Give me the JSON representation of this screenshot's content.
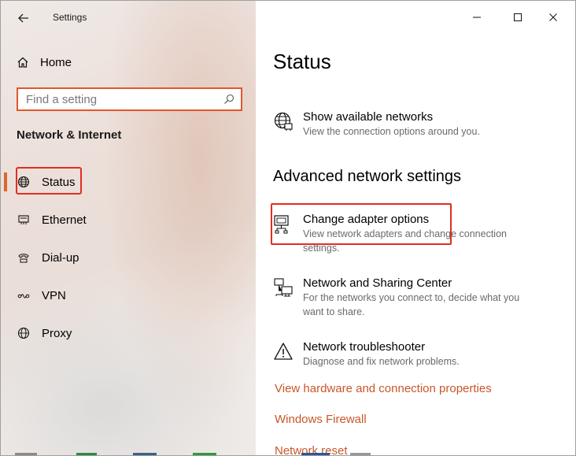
{
  "window": {
    "app_title": "Settings"
  },
  "sidebar": {
    "home_label": "Home",
    "search_placeholder": "Find a setting",
    "section_title": "Network & Internet",
    "items": [
      {
        "label": "Status",
        "icon": "globe-icon",
        "active": true
      },
      {
        "label": "Ethernet",
        "icon": "ethernet-icon"
      },
      {
        "label": "Dial-up",
        "icon": "dialup-icon"
      },
      {
        "label": "VPN",
        "icon": "vpn-icon"
      },
      {
        "label": "Proxy",
        "icon": "globe-icon"
      }
    ]
  },
  "main": {
    "title": "Status",
    "show_networks": {
      "title": "Show available networks",
      "desc": "View the connection options around you."
    },
    "advanced_title": "Advanced network settings",
    "rows": [
      {
        "title": "Change adapter options",
        "desc": "View network adapters and change connection settings.",
        "icon": "adapter-icon"
      },
      {
        "title": "Network and Sharing Center",
        "desc": "For the networks you connect to, decide what you want to share.",
        "icon": "sharing-icon"
      },
      {
        "title": "Network troubleshooter",
        "desc": "Diagnose and fix network problems.",
        "icon": "warning-icon"
      }
    ],
    "links": [
      "View hardware and connection properties",
      "Windows Firewall",
      "Network reset"
    ]
  },
  "colors": {
    "accent": "#d8692e",
    "highlight": "#e32d20",
    "link": "#c9572a"
  }
}
